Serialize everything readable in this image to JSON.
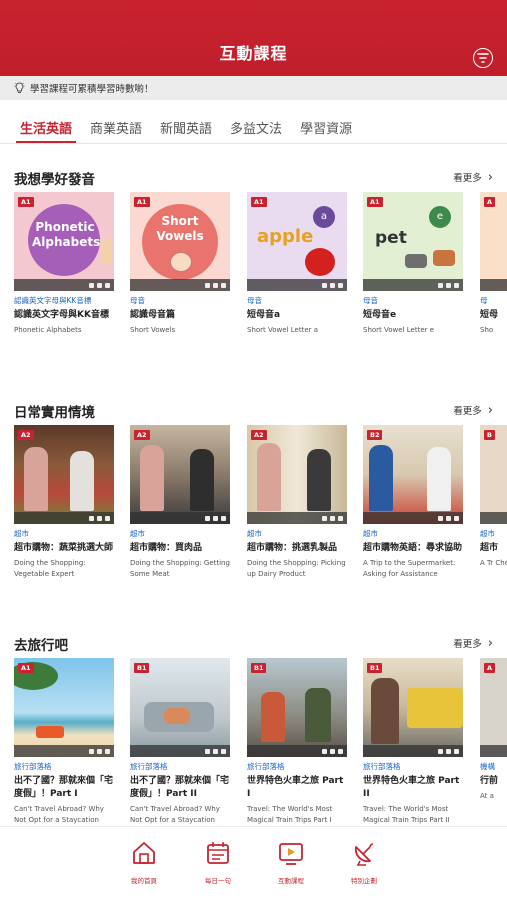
{
  "header": {
    "title": "互動課程",
    "filter_icon": "filter-icon"
  },
  "tip": {
    "text": "學習課程可累積學習時數喲！",
    "icon": "lightbulb-icon"
  },
  "tabs": [
    {
      "label": "生活英語",
      "active": true
    },
    {
      "label": "商業英語",
      "active": false
    },
    {
      "label": "新聞英語",
      "active": false
    },
    {
      "label": "多益文法",
      "active": false
    },
    {
      "label": "學習資源",
      "active": false
    }
  ],
  "sections": [
    {
      "title": "我想學好發音",
      "more": "看更多",
      "cards": [
        {
          "level": "A1",
          "thumb_text": "Phonetic Alphabets",
          "category": "認識英文字母與KK音標",
          "title": "認識英文字母與KK音標",
          "subtitle": "Phonetic Alphabets"
        },
        {
          "level": "A1",
          "thumb_text": "Short Vowels",
          "category": "母音",
          "title": "認識母音篇",
          "subtitle": "Short Vowels"
        },
        {
          "level": "A1",
          "thumb_text": "apple",
          "category": "母音",
          "title": "短母音a",
          "subtitle": "Short Vowel Letter a"
        },
        {
          "level": "A1",
          "thumb_text": "pet",
          "category": "母音",
          "title": "短母音e",
          "subtitle": "Short Vowel Letter e"
        },
        {
          "level": "A",
          "thumb_text": "",
          "category": "母",
          "title": "短母",
          "subtitle": "Sho"
        }
      ]
    },
    {
      "title": "日常實用情境",
      "more": "看更多",
      "cards": [
        {
          "level": "A2",
          "category": "超市",
          "title": "超市購物：蔬菜挑選大師",
          "subtitle": "Doing the Shopping: Vegetable Expert"
        },
        {
          "level": "A2",
          "category": "超市",
          "title": "超市購物：買肉品",
          "subtitle": "Doing the Shopping: Getting Some Meat"
        },
        {
          "level": "A2",
          "category": "超市",
          "title": "超市購物：挑選乳製品",
          "subtitle": "Doing the Shopping: Picking up Dairy Product"
        },
        {
          "level": "B2",
          "category": "超市",
          "title": "超市購物英語：尋求協助",
          "subtitle": "A Trip to the Supermarket: Asking for Assistance"
        },
        {
          "level": "B",
          "category": "超市",
          "title": "超市",
          "subtitle": "A Tr Che"
        }
      ]
    },
    {
      "title": "去旅行吧",
      "more": "看更多",
      "cards": [
        {
          "level": "A1",
          "category": "旅行部落格",
          "title": "出不了國？那就來個「宅度假」！Part I",
          "subtitle": "Can't Travel Abroad? Why Not Opt for a Staycation"
        },
        {
          "level": "B1",
          "category": "旅行部落格",
          "title": "出不了國？那就來個「宅度假」！Part II",
          "subtitle": "Can't Travel Abroad? Why Not Opt for a Staycation"
        },
        {
          "level": "B1",
          "category": "旅行部落格",
          "title": "世界特色火車之旅 Part I",
          "subtitle": "Travel: The World's Most Magical Train Trips Part I"
        },
        {
          "level": "B1",
          "category": "旅行部落格",
          "title": "世界特色火車之旅 Part II",
          "subtitle": "Travel: The World's Most Magical Train Trips Part II"
        },
        {
          "level": "A",
          "category": "機構",
          "title": "行前",
          "subtitle": "At a"
        }
      ]
    }
  ],
  "bottom_nav": [
    {
      "label": "我的首頁",
      "icon": "home-icon"
    },
    {
      "label": "每日一句",
      "icon": "calendar-icon"
    },
    {
      "label": "互動課程",
      "icon": "video-play-icon"
    },
    {
      "label": "特別企劃",
      "icon": "satellite-dish-icon"
    }
  ],
  "colors": {
    "brand": "#c8232f",
    "category": "#1a64c8"
  }
}
